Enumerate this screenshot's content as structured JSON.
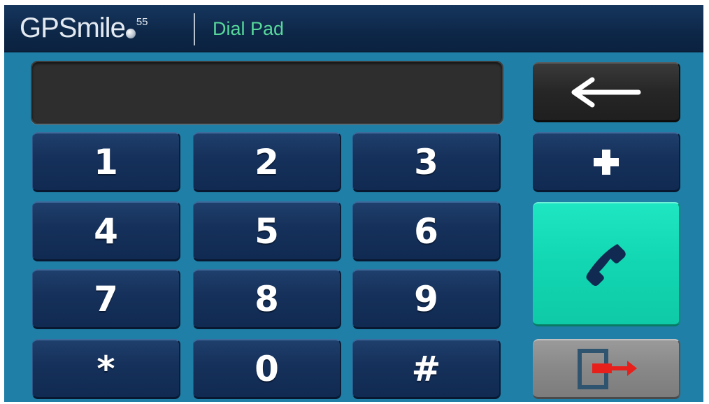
{
  "header": {
    "brand_name": "GPSmile",
    "brand_superscript": "55",
    "title": "Dial Pad",
    "title_color": "#57d89a"
  },
  "display": {
    "value": ""
  },
  "keypad": {
    "keys": [
      "1",
      "2",
      "3",
      "4",
      "5",
      "6",
      "7",
      "8",
      "9",
      "*",
      "0",
      "#"
    ]
  },
  "side_buttons": {
    "backspace_icon": "left-arrow-icon",
    "plus_icon": "plus-icon",
    "call_icon": "phone-icon",
    "exit_icon": "exit-door-icon",
    "call_color": "#12d6b2",
    "exit_arrow_color": "#e8201c"
  }
}
